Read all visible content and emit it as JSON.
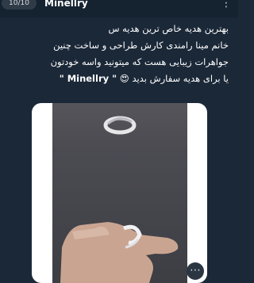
{
  "header": {
    "counter": "10/10",
    "username": "Minellry",
    "more_icon": "more-icon"
  },
  "caption": {
    "line1": "بهترین هدیه خاص ترین هدیه س",
    "line2": "خانم مینا رامندی کارش طراحی و ساخت چنین",
    "line3": "جواهرات زیبایی هست که میتونید واسه خودتون",
    "line4_prefix": "یا برای هدیه سفارش بدید",
    "line4_emoji": "😍",
    "line4_brand": "\" Minellry \""
  },
  "colors": {
    "background": "#1b2838",
    "photo_card": "#ffffff",
    "photo_dark": "#45454b"
  }
}
